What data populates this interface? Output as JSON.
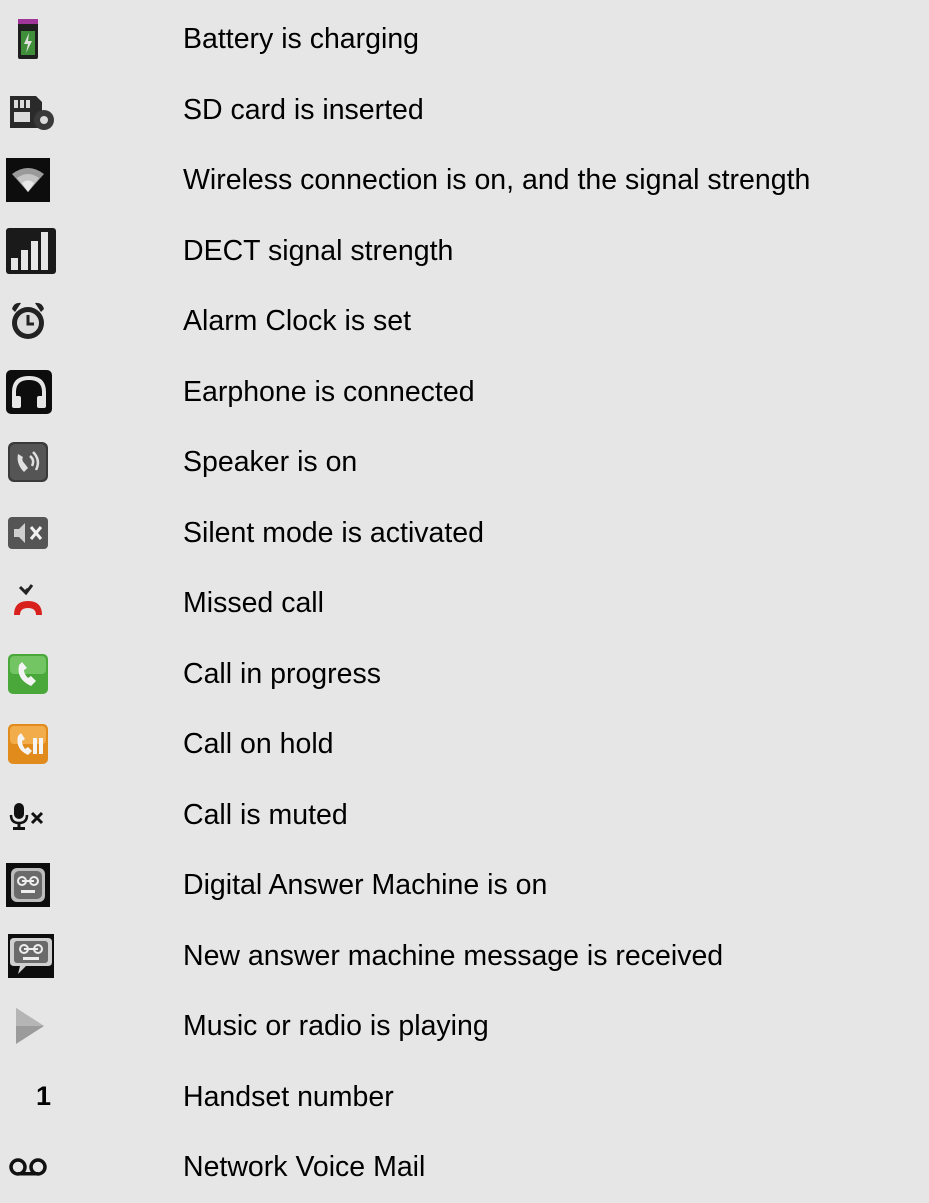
{
  "legend": {
    "items": [
      {
        "icon": "battery-charging-icon",
        "label": "Battery is charging"
      },
      {
        "icon": "sd-card-icon",
        "label": "SD card is inserted"
      },
      {
        "icon": "wifi-icon",
        "label": "Wireless connection is on, and the signal strength"
      },
      {
        "icon": "dect-signal-icon",
        "label": "DECT signal strength"
      },
      {
        "icon": "alarm-clock-icon",
        "label": "Alarm Clock is set"
      },
      {
        "icon": "headphones-icon",
        "label": "Earphone is connected"
      },
      {
        "icon": "speaker-icon",
        "label": "Speaker is on"
      },
      {
        "icon": "silent-mode-icon",
        "label": "Silent mode is activated"
      },
      {
        "icon": "missed-call-icon",
        "label": "Missed call"
      },
      {
        "icon": "call-in-progress-icon",
        "label": "Call in progress"
      },
      {
        "icon": "call-on-hold-icon",
        "label": "Call on hold"
      },
      {
        "icon": "mic-muted-icon",
        "label": "Call is muted"
      },
      {
        "icon": "answer-machine-icon",
        "label": "Digital Answer Machine is on"
      },
      {
        "icon": "new-message-icon",
        "label": "New answer machine message is received"
      },
      {
        "icon": "play-icon",
        "label": "Music or radio is playing"
      },
      {
        "icon": "handset-number-icon",
        "label": "Handset number",
        "glyph": "1"
      },
      {
        "icon": "voicemail-icon",
        "label": "Network Voice Mail"
      }
    ]
  }
}
